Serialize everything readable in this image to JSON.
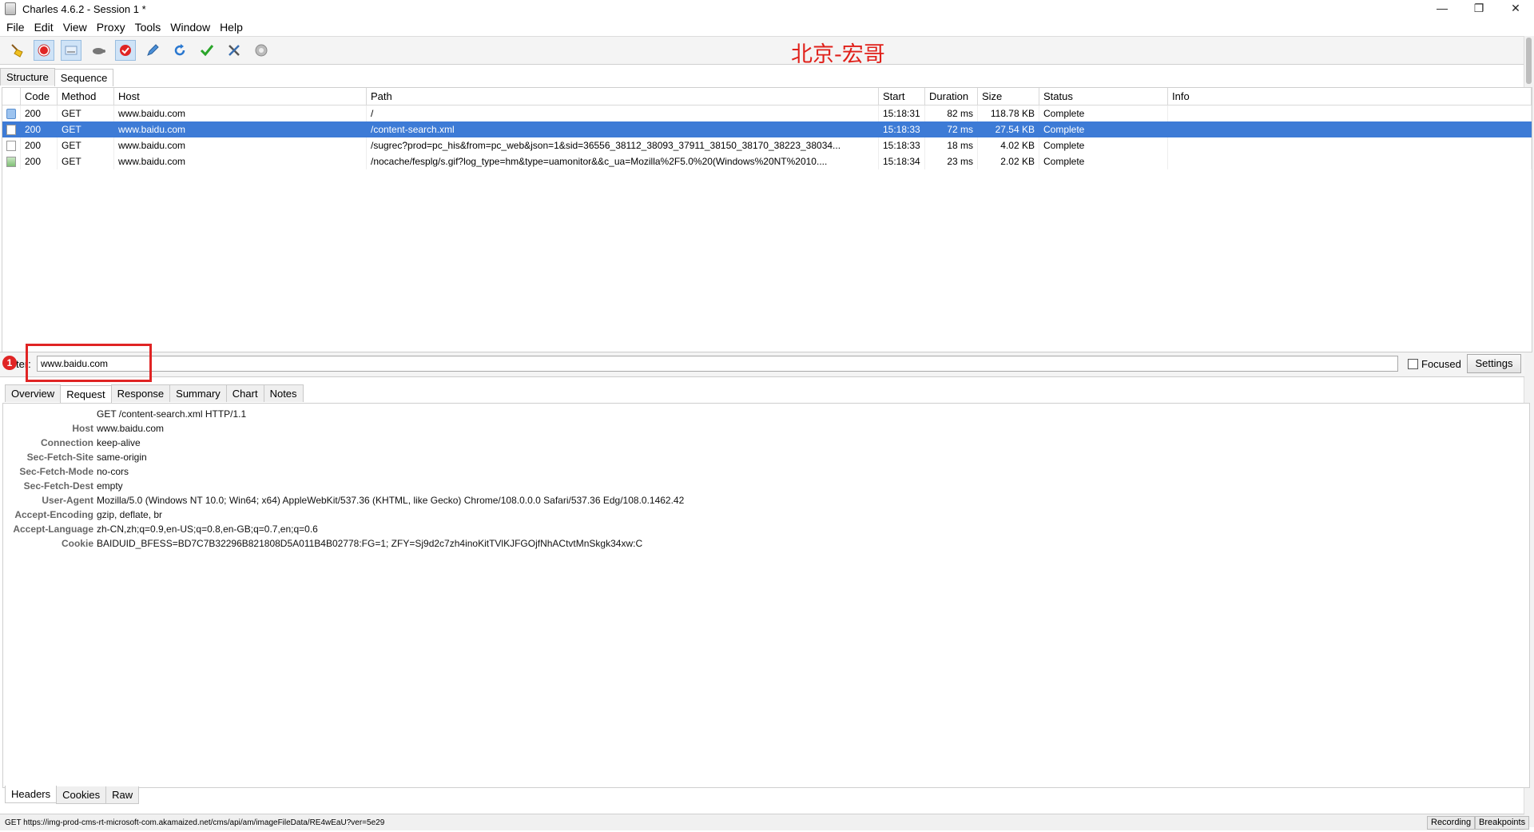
{
  "window": {
    "title": "Charles 4.6.2 - Session 1 *",
    "controls": [
      "—",
      "❐",
      "✕"
    ]
  },
  "menu": [
    "File",
    "Edit",
    "View",
    "Proxy",
    "Tools",
    "Window",
    "Help"
  ],
  "toolbar": {
    "icons": [
      "broom-icon",
      "record-icon",
      "throttle-icon",
      "turtle-icon",
      "breakpoint-icon",
      "pen-icon",
      "refresh-icon",
      "check-icon",
      "tools-icon",
      "settings-gear-icon"
    ],
    "watermark": "北京-宏哥"
  },
  "top_tabs": [
    "Structure",
    "Sequence"
  ],
  "table": {
    "columns": [
      "Code",
      "Method",
      "Host",
      "Path",
      "Start",
      "Duration",
      "Size",
      "Status",
      "Info"
    ],
    "rows": [
      [
        "200",
        "GET",
        "www.baidu.com",
        "/",
        "15:18:31",
        "82 ms",
        "118.78 KB",
        "Complete",
        ""
      ],
      [
        "200",
        "GET",
        "www.baidu.com",
        "/content-search.xml",
        "15:18:33",
        "72 ms",
        "27.54 KB",
        "Complete",
        ""
      ],
      [
        "200",
        "GET",
        "www.baidu.com",
        "/sugrec?prod=pc_his&from=pc_web&json=1&sid=36556_38112_38093_37911_38150_38170_38223_38034...",
        "15:18:33",
        "18 ms",
        "4.02 KB",
        "Complete",
        ""
      ],
      [
        "200",
        "GET",
        "www.baidu.com",
        "/nocache/fesplg/s.gif?log_type=hm&type=uamonitor&&c_ua=Mozilla%2F5.0%20(Windows%20NT%2010....",
        "15:18:34",
        "23 ms",
        "2.02 KB",
        "Complete",
        ""
      ]
    ],
    "selected_row": 1
  },
  "filter": {
    "label": "ter:",
    "value": "www.baidu.com",
    "focused_label": "Focused",
    "settings_label": "Settings",
    "badge": "1"
  },
  "detail_tabs": [
    "Overview",
    "Request",
    "Response",
    "Summary",
    "Chart",
    "Notes"
  ],
  "request": {
    "request_line": "GET /content-search.xml HTTP/1.1",
    "headers": [
      {
        "k": "Host",
        "v": "www.baidu.com"
      },
      {
        "k": "Connection",
        "v": "keep-alive"
      },
      {
        "k": "Sec-Fetch-Site",
        "v": "same-origin"
      },
      {
        "k": "Sec-Fetch-Mode",
        "v": "no-cors"
      },
      {
        "k": "Sec-Fetch-Dest",
        "v": "empty"
      },
      {
        "k": "User-Agent",
        "v": "Mozilla/5.0 (Windows NT 10.0; Win64; x64) AppleWebKit/537.36 (KHTML, like Gecko) Chrome/108.0.0.0 Safari/537.36 Edg/108.0.1462.42"
      },
      {
        "k": "Accept-Encoding",
        "v": "gzip, deflate, br"
      },
      {
        "k": "Accept-Language",
        "v": "zh-CN,zh;q=0.9,en-US;q=0.8,en-GB;q=0.7,en;q=0.6"
      },
      {
        "k": "Cookie",
        "v": "BAIDUID_BFESS=BD7C7B32296B821808D5A011B4B02778:FG=1; ZFY=Sj9d2c7zh4inoKitTVlKJFGOjfNhACtvtMnSkgk34xw:C"
      }
    ]
  },
  "bottom_tabs": [
    "Headers",
    "Cookies",
    "Raw"
  ],
  "status": {
    "message": "GET https://img-prod-cms-rt-microsoft-com.akamaized.net/cms/api/am/imageFileData/RE4wEaU?ver=5e29",
    "recording": "Recording",
    "breakpoints": "Breakpoints"
  }
}
